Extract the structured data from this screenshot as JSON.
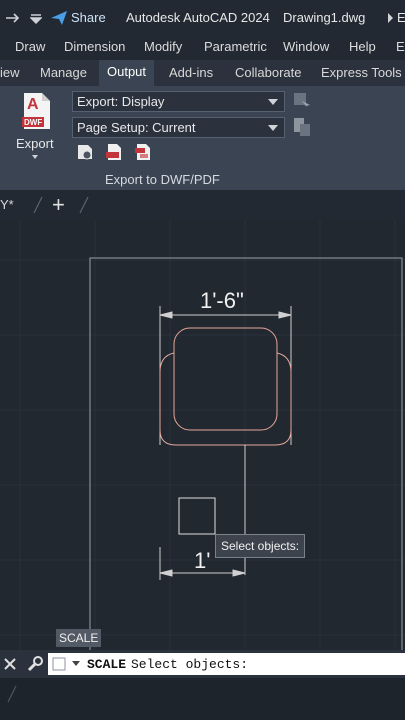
{
  "titlebar": {
    "share_label": "Share",
    "app_title": "Autodesk AutoCAD 2024",
    "file_name": "Drawing1.dwg",
    "overflow": "E"
  },
  "menubar": {
    "items": [
      "Draw",
      "Dimension",
      "Modify",
      "Parametric",
      "Window",
      "Help",
      "Ex"
    ]
  },
  "ribbon_tabs": {
    "items": [
      "iew",
      "Manage",
      "Output",
      "Add-ins",
      "Collaborate",
      "Express Tools"
    ],
    "active": "Output"
  },
  "ribbon": {
    "export_label": "Export",
    "export_badge": "DWF",
    "export_letter": "A",
    "export_display": "Export: Display",
    "page_setup": "Page Setup: Current",
    "panel_title": "Export to DWF/PDF"
  },
  "doc_tabs": {
    "current": "Y*",
    "add_label": "+"
  },
  "drawing": {
    "dim_top": "1'-6\"",
    "dim_bottom": "1'",
    "tooltip": "Select objects:"
  },
  "command": {
    "scale_tooltip": "SCALE",
    "command_name": "SCALE",
    "prompt": "Select objects:"
  },
  "colors": {
    "accent_red": "#c2363b",
    "dimension": "#d0d0d0",
    "geometry_pink": "#e7a79a"
  }
}
